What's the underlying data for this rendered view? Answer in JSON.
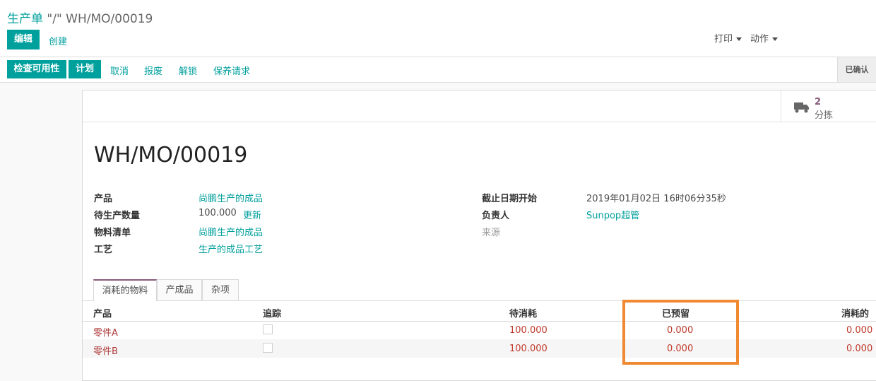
{
  "breadcrumb": {
    "parent": "生产单",
    "current": "\"/\" WH/MO/00019"
  },
  "control": {
    "edit": "编辑",
    "create": "创建",
    "print": "打印",
    "action": "动作"
  },
  "statusbar": {
    "buttons": [
      "检查可用性",
      "计划"
    ],
    "links": [
      "取消",
      "报废",
      "解锁",
      "保养请求"
    ],
    "state": "已确认"
  },
  "smart_button": {
    "count": "2",
    "label": "分拣",
    "icon": "truck-icon"
  },
  "record": {
    "title": "WH/MO/00019",
    "left_fields": [
      {
        "label": "产品",
        "value": "尚鹏生产的成品"
      },
      {
        "label": "待生产数量",
        "value": "100.000",
        "extra": "更新"
      },
      {
        "label": "物料清单",
        "value": "尚鹏生产的成品"
      },
      {
        "label": "工艺",
        "value": "生产的成品工艺"
      }
    ],
    "right_fields": [
      {
        "label": "截止日期开始",
        "value": "2019年01月02日 16时06分35秒"
      },
      {
        "label": "负责人",
        "value": "Sunpop超管"
      },
      {
        "label": "来源",
        "value": ""
      }
    ]
  },
  "tabs": [
    "消耗的物料",
    "产成品",
    "杂项"
  ],
  "table": {
    "headers": [
      "产品",
      "追踪",
      "待消耗",
      "已预留",
      "消耗的"
    ],
    "rows": [
      {
        "product": "零件A",
        "to_consume": "100.000",
        "reserved": "0.000",
        "consumed": "0.000"
      },
      {
        "product": "零件B",
        "to_consume": "100.000",
        "reserved": "0.000",
        "consumed": "0.000"
      }
    ]
  },
  "colors": {
    "primary": "#00a09d",
    "accent": "#875a7b",
    "highlight": "#f08a32",
    "warning_text": "#c0392b"
  }
}
